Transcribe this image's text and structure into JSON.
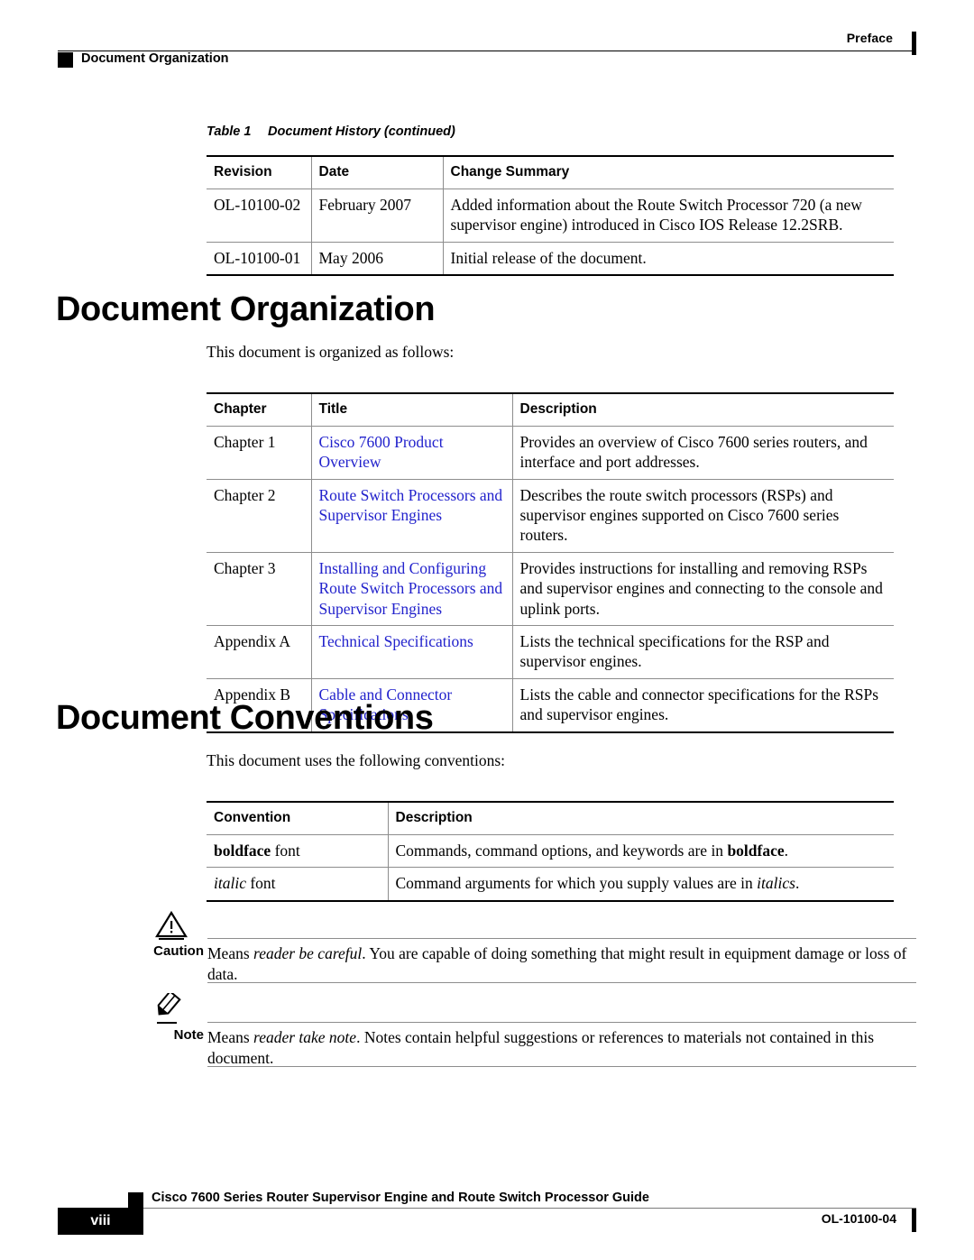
{
  "header": {
    "left_label": "Document Organization",
    "right_label": "Preface"
  },
  "history_table": {
    "caption_number": "Table 1",
    "caption_title": "Document History (continued)",
    "columns": [
      "Revision",
      "Date",
      "Change Summary"
    ],
    "rows": [
      {
        "revision": "OL-10100-02",
        "date": "February 2007",
        "summary": "Added information about the Route Switch Processor 720 (a new supervisor engine) introduced in Cisco IOS Release 12.2SRB."
      },
      {
        "revision": "OL-10100-01",
        "date": "May 2006",
        "summary": "Initial release of the document."
      }
    ]
  },
  "organization": {
    "heading": "Document Organization",
    "intro": "This document is organized as follows:",
    "columns": [
      "Chapter",
      "Title",
      "Description"
    ],
    "rows": [
      {
        "chapter": "Chapter 1",
        "title": "Cisco 7600 Product Overview",
        "description": "Provides an overview of Cisco 7600 series routers, and interface and port addresses."
      },
      {
        "chapter": "Chapter 2",
        "title": "Route Switch Processors and Supervisor Engines",
        "description": "Describes the route switch processors (RSPs) and supervisor engines supported on Cisco 7600 series routers."
      },
      {
        "chapter": "Chapter 3",
        "title": "Installing and Configuring Route Switch Processors and Supervisor Engines",
        "description": "Provides instructions for installing and removing RSPs and supervisor engines and connecting to the console and uplink ports."
      },
      {
        "chapter": "Appendix A",
        "title": "Technical Specifications",
        "description": "Lists the technical specifications for the RSP and supervisor engines."
      },
      {
        "chapter": "Appendix B",
        "title": "Cable and Connector Specifications",
        "description": "Lists the cable and connector specifications for the RSPs and supervisor engines."
      }
    ]
  },
  "conventions": {
    "heading": "Document Conventions",
    "intro": "This document uses the following conventions:",
    "columns": [
      "Convention",
      "Description"
    ],
    "rows": [
      {
        "convention_bold": "boldface",
        "convention_rest": " font",
        "description_pre": "Commands, command options, and keywords are in ",
        "description_em": "boldface",
        "description_post": "."
      },
      {
        "convention_italic": "italic",
        "convention_rest": " font",
        "description_pre": "Command arguments for which you supply values are in ",
        "description_em": "italics",
        "description_post": "."
      }
    ]
  },
  "admonitions": [
    {
      "icon": "caution-triangle-icon",
      "label": "Caution",
      "lead": "Means ",
      "emphasis": "reader be careful",
      "body": ". You are capable of doing something that might result in equipment damage or loss of data."
    },
    {
      "icon": "note-pencil-icon",
      "label": "Note",
      "lead": "Means ",
      "emphasis": "reader take note",
      "body": ". Notes contain helpful suggestions or references to materials not contained in this document."
    }
  ],
  "footer": {
    "title": "Cisco 7600 Series Router Supervisor Engine and Route Switch Processor Guide",
    "page_number": "viii",
    "doc_id": "OL-10100-04"
  },
  "colors": {
    "link": "#2222cc",
    "rule": "#8d8d8d",
    "text": "#000000"
  }
}
